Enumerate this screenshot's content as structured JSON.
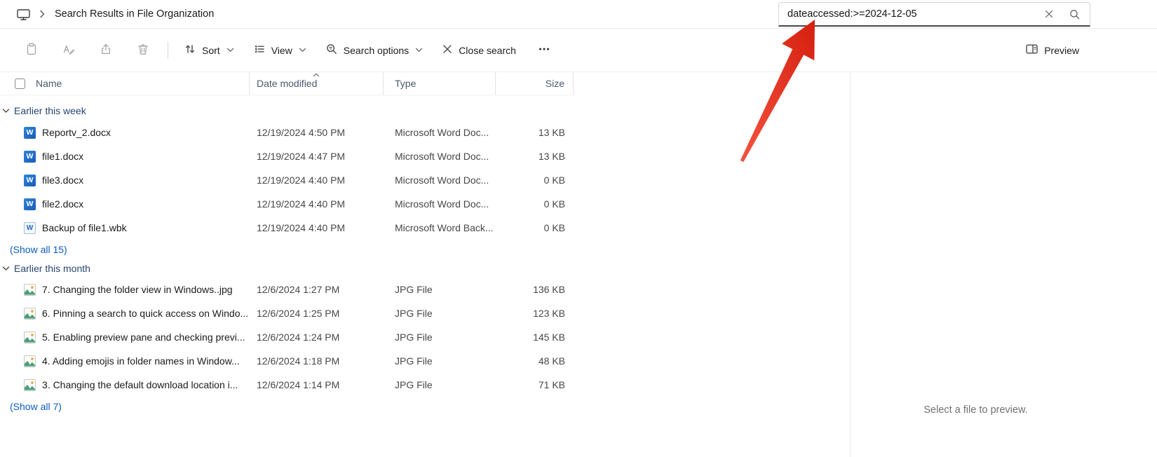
{
  "window": {
    "breadcrumb_title": "Search Results in File Organization"
  },
  "search": {
    "query_misspelled": "dateaccessed",
    "query_rest": ":>=2024-12-05",
    "full_query": "dateaccessed:>=2024-12-05"
  },
  "toolbar": {
    "sort": "Sort",
    "view": "View",
    "search_options": "Search options",
    "close_search": "Close search",
    "preview": "Preview"
  },
  "columns": {
    "name": "Name",
    "date_modified": "Date modified",
    "type": "Type",
    "size": "Size",
    "sorted_by": "Date modified",
    "sort_direction": "ascending"
  },
  "list": {
    "groups": [
      {
        "label": "Earlier this week",
        "show_all": "(Show all 15)",
        "rows": [
          {
            "icon": "word-document-icon",
            "name": "Reportv_2.docx",
            "date": "12/19/2024 4:50 PM",
            "type": "Microsoft Word Doc...",
            "size": "13 KB"
          },
          {
            "icon": "word-document-icon",
            "name": "file1.docx",
            "date": "12/19/2024 4:47 PM",
            "type": "Microsoft Word Doc...",
            "size": "13 KB"
          },
          {
            "icon": "word-document-icon",
            "name": "file3.docx",
            "date": "12/19/2024 4:40 PM",
            "type": "Microsoft Word Doc...",
            "size": "0 KB"
          },
          {
            "icon": "word-document-icon",
            "name": "file2.docx",
            "date": "12/19/2024 4:40 PM",
            "type": "Microsoft Word Doc...",
            "size": "0 KB"
          },
          {
            "icon": "word-backup-icon",
            "name": "Backup of file1.wbk",
            "date": "12/19/2024 4:40 PM",
            "type": "Microsoft Word Back...",
            "size": "0 KB"
          }
        ]
      },
      {
        "label": "Earlier this month",
        "show_all": "(Show all 7)",
        "rows": [
          {
            "icon": "jpg-image-icon",
            "name": "7. Changing the folder view in Windows..jpg",
            "date": "12/6/2024 1:27 PM",
            "type": "JPG File",
            "size": "136 KB"
          },
          {
            "icon": "jpg-image-icon",
            "name": "6. Pinning a search to quick access on Windo...",
            "date": "12/6/2024 1:25 PM",
            "type": "JPG File",
            "size": "123 KB"
          },
          {
            "icon": "jpg-image-icon",
            "name": "5. Enabling preview pane and checking previ...",
            "date": "12/6/2024 1:24 PM",
            "type": "JPG File",
            "size": "145 KB"
          },
          {
            "icon": "jpg-image-icon",
            "name": "4. Adding emojis in folder names in Window...",
            "date": "12/6/2024 1:18 PM",
            "type": "JPG File",
            "size": "48 KB"
          },
          {
            "icon": "jpg-image-icon",
            "name": "3. Changing the default download location i...",
            "date": "12/6/2024 1:14 PM",
            "type": "JPG File",
            "size": "71 KB"
          }
        ]
      }
    ]
  },
  "preview_pane": {
    "placeholder": "Select a file to preview."
  },
  "annotation": {
    "type": "red-arrow",
    "color": "#e8301c"
  }
}
